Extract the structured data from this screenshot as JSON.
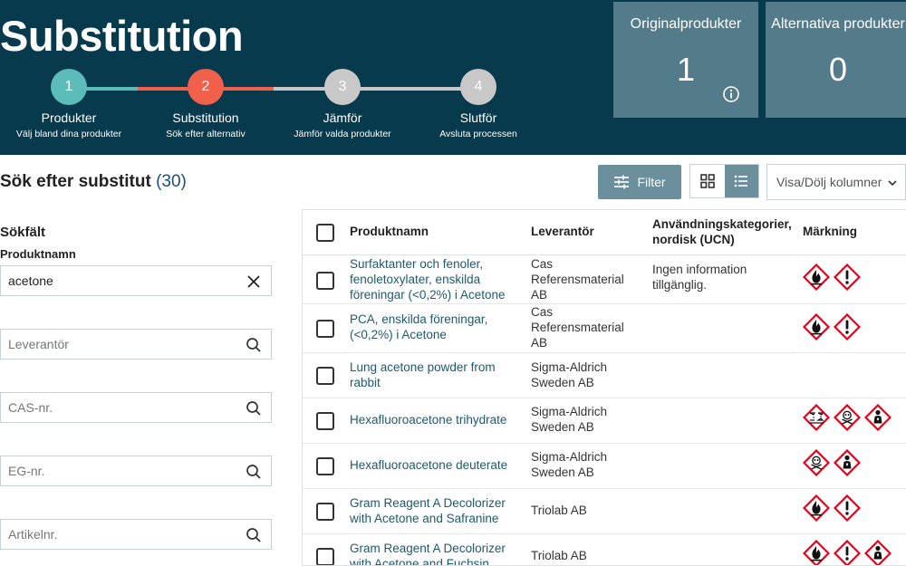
{
  "header": {
    "title": "Substitution",
    "steps": [
      {
        "num": "1",
        "label": "Produkter",
        "sub": "Välj bland dina produkter",
        "color": "#5bbcba"
      },
      {
        "num": "2",
        "label": "Substitution",
        "sub": "Sök efter alternativ",
        "color": "#f0604a"
      },
      {
        "num": "3",
        "label": "Jämför",
        "sub": "Jämför valda produkter",
        "color": "#c8c8c8"
      },
      {
        "num": "4",
        "label": "Slutför",
        "sub": "Avsluta processen",
        "color": "#c8c8c8"
      }
    ],
    "counters": [
      {
        "label": "Originalprodukter",
        "value": "1"
      },
      {
        "label": "Alternativa produkter",
        "value": "0"
      }
    ]
  },
  "toolbar": {
    "heading": "Sök efter substitut",
    "count": "(30)",
    "filter_label": "Filter",
    "columns_label": "Visa/Dölj kolumner"
  },
  "search": {
    "heading": "Sökfält",
    "product_label": "Produktnamn",
    "product_value": "acetone",
    "supplier_placeholder": "Leverantör",
    "cas_placeholder": "CAS-nr.",
    "eg_placeholder": "EG-nr.",
    "article_placeholder": "Artikelnr."
  },
  "table": {
    "headers": {
      "name": "Produktnamn",
      "supplier": "Leverantör",
      "usage": "Användningskategorier, nordisk (UCN)",
      "marking": "Märkning"
    },
    "rows": [
      {
        "name": "Surfaktanter och fenoler, fenoletoxylater, enskilda föreningar (<0,2%) i Acetone",
        "supplier": "Cas Referensmaterial AB",
        "usage": "Ingen information tillgänglig.",
        "pictograms": [
          "flame-icon",
          "exclamation-icon"
        ]
      },
      {
        "name": "PCA, enskilda föreningar, (<0,2%) i Acetone",
        "supplier": "Cas Referensmaterial AB",
        "usage": "",
        "pictograms": [
          "flame-icon",
          "exclamation-icon"
        ]
      },
      {
        "name": "Lung acetone powder from rabbit",
        "supplier": "Sigma-Aldrich Sweden AB",
        "usage": "",
        "pictograms": []
      },
      {
        "name": "Hexafluoroacetone trihydrate",
        "supplier": "Sigma-Aldrich Sweden AB",
        "usage": "",
        "pictograms": [
          "corrosion-icon",
          "skull-icon",
          "health-hazard-icon"
        ]
      },
      {
        "name": "Hexafluoroacetone deuterate",
        "supplier": "Sigma-Aldrich Sweden AB",
        "usage": "",
        "pictograms": [
          "skull-icon",
          "health-hazard-icon"
        ]
      },
      {
        "name": "Gram Reagent A Decolorizer with Acetone and Safranine",
        "supplier": "Triolab AB",
        "usage": "",
        "pictograms": [
          "flame-icon",
          "exclamation-icon"
        ]
      },
      {
        "name": "Gram Reagent A Decolorizer with Acetone and Fuchsin",
        "supplier": "Triolab AB",
        "usage": "",
        "pictograms": [
          "flame-icon",
          "exclamation-icon",
          "health-hazard-icon"
        ]
      }
    ]
  }
}
